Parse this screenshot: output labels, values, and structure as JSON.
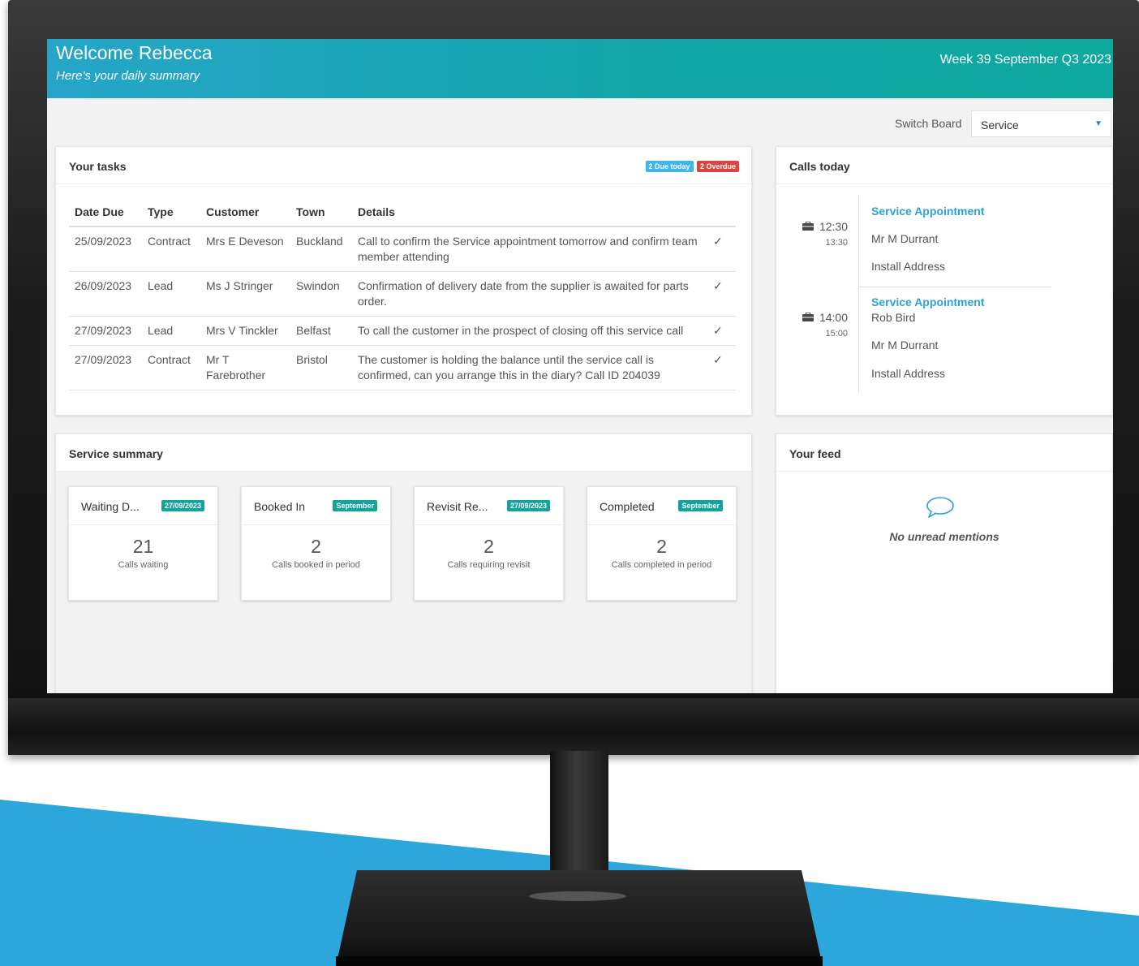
{
  "colors": {
    "header_start": "#26a5c9",
    "header_end": "#0ea99e",
    "link_blue": "#2aa3d6",
    "overdue_red": "#e0403a",
    "badge_blue": "#3eb6e6",
    "badge_red": "#d9463f",
    "badge_teal": "#13a39a",
    "background_accent": "#2da6dc"
  },
  "header": {
    "welcome": "Welcome Rebecca",
    "subtitle": "Here's your daily summary",
    "week": "Week 39 September Q3 2023"
  },
  "switch_board": {
    "label": "Switch Board",
    "selected": "Service"
  },
  "tasks": {
    "title": "Your tasks",
    "badge_due": "2 Due today",
    "badge_overdue": "2 Overdue",
    "columns": [
      "Date Due",
      "Type",
      "Customer",
      "Town",
      "Details"
    ],
    "rows": [
      {
        "date": "25/09/2023",
        "overdue": true,
        "type": "Contract",
        "customer": "Mrs E Deveson",
        "town": "Buckland",
        "details": "Call to confirm the Service appointment tomorrow and confirm team member attending"
      },
      {
        "date": "26/09/2023",
        "overdue": true,
        "type": "Lead",
        "customer": "Ms J Stringer",
        "town": "Swindon",
        "details": "Confirmation of delivery date from the supplier is awaited for parts order."
      },
      {
        "date": "27/09/2023",
        "overdue": false,
        "type": "Lead",
        "customer": "Mrs V Tinckler",
        "town": "Belfast",
        "details": "To call the customer in the prospect of closing off this service call"
      },
      {
        "date": "27/09/2023",
        "overdue": false,
        "type": "Contract",
        "customer": "Mr T Farebrother",
        "town": "Bristol",
        "details": "The customer is holding the balance until the service call is confirmed, can you arrange this in the diary? Call ID 204039"
      }
    ],
    "row_icon": "check-icon"
  },
  "calls": {
    "title": "Calls today",
    "items": [
      {
        "start": "12:30",
        "end": "13:30",
        "title": "Service Appointment",
        "person": "",
        "contact": "Mr M Durrant",
        "address": "Install Address",
        "icon": "briefcase-icon"
      },
      {
        "start": "14:00",
        "end": "15:00",
        "title": "Service Appointment",
        "person": "Rob Bird",
        "contact": "Mr M Durrant",
        "address": "Install Address",
        "icon": "briefcase-icon"
      }
    ]
  },
  "summary": {
    "title": "Service summary",
    "cards": [
      {
        "title": "Waiting D...",
        "badge": "27/09/2023",
        "value": "21",
        "caption": "Calls waiting"
      },
      {
        "title": "Booked In",
        "badge": "September",
        "value": "2",
        "caption": "Calls booked in period"
      },
      {
        "title": "Revisit Re...",
        "badge": "27/09/2023",
        "value": "2",
        "caption": "Calls requiring revisit"
      },
      {
        "title": "Completed",
        "badge": "September",
        "value": "2",
        "caption": "Calls completed in period"
      }
    ]
  },
  "feed": {
    "title": "Your feed",
    "empty_text": "No unread mentions",
    "icon": "speech-bubble-icon"
  }
}
